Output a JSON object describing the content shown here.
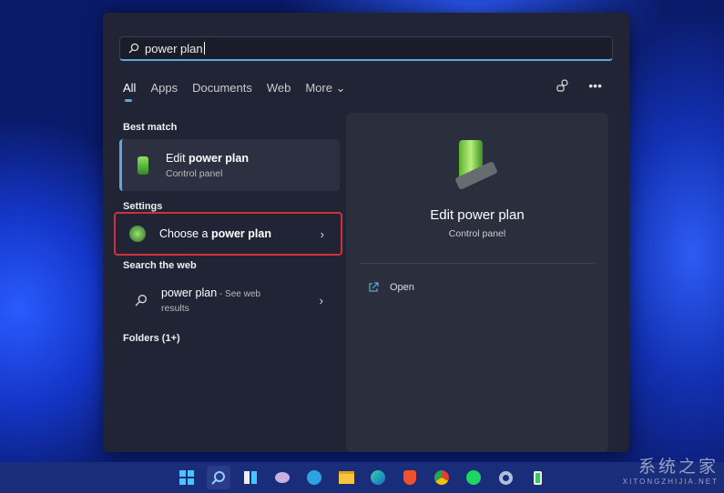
{
  "search": {
    "value": "power plan",
    "icon": "search-icon"
  },
  "tabs": [
    {
      "label": "All",
      "active": true
    },
    {
      "label": "Apps"
    },
    {
      "label": "Documents"
    },
    {
      "label": "Web"
    },
    {
      "label": "More ⌄"
    }
  ],
  "toolbar": {
    "account_icon": "people-icon",
    "more_icon": "ellipsis-icon"
  },
  "left": {
    "best_match_label": "Best match",
    "best_match": {
      "title_pre": "Edit ",
      "title_bold": "power plan",
      "subtitle": "Control panel"
    },
    "settings_label": "Settings",
    "settings_item": {
      "title_pre": "Choose a ",
      "title_bold": "power plan"
    },
    "web_label": "Search the web",
    "web_item": {
      "title": "power plan",
      "suffix": " - See web",
      "suffix2": "results"
    },
    "folders_label": "Folders (1+)"
  },
  "right": {
    "title": "Edit power plan",
    "subtitle": "Control panel",
    "open_label": "Open"
  },
  "accent": "#5fa8d8",
  "highlight": "#d0303a",
  "taskbar": [
    "windows-start",
    "search",
    "task-view",
    "widgets",
    "telegram",
    "file-explorer",
    "edge",
    "brave",
    "chrome",
    "spotify",
    "settings",
    "battery"
  ],
  "watermark": {
    "cn": "系统之家",
    "en": "XITONGZHIJIA.NET"
  }
}
